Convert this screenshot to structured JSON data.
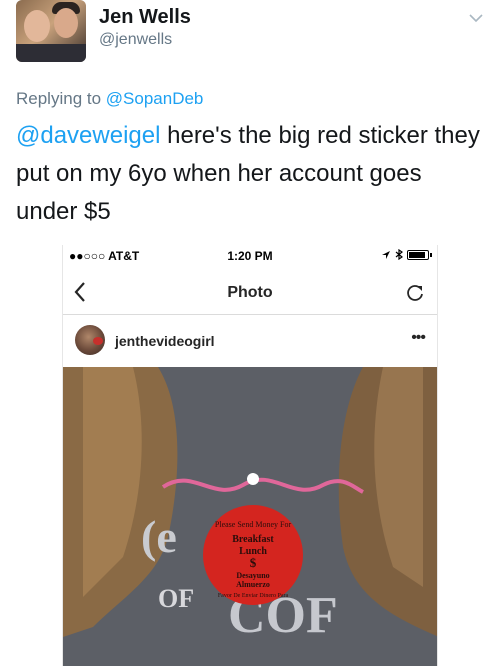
{
  "tweet": {
    "author_name": "Jen Wells",
    "author_handle": "@jenwells",
    "reply_prefix": "Replying to ",
    "reply_to": "@SopanDeb",
    "mention": "@daveweigel",
    "body": " here's the big red sticker they put on my 6yo when her account goes under $5",
    "icons": {
      "menu": "chevron-down-icon"
    }
  },
  "screenshot": {
    "status_bar": {
      "carrier": "●●○○○ AT&T",
      "time": "1:20 PM"
    },
    "nav": {
      "title": "Photo",
      "back_icon": "chevron-left-icon",
      "refresh_icon": "refresh-icon"
    },
    "post": {
      "username": "jenthevideogirl",
      "more_icon": "ellipsis-icon"
    },
    "photo": {
      "sticker_text": [
        "Please Send Money For",
        "Breakfast",
        "Lunch",
        "$",
        "Desayuno",
        "Almuerzo",
        "Favor De Enviar Dinero Para"
      ],
      "shirt_text": [
        "OF",
        "COF"
      ]
    }
  },
  "colors": {
    "link": "#1da1f2",
    "secondary": "#657786",
    "sticker": "#d4251f"
  }
}
